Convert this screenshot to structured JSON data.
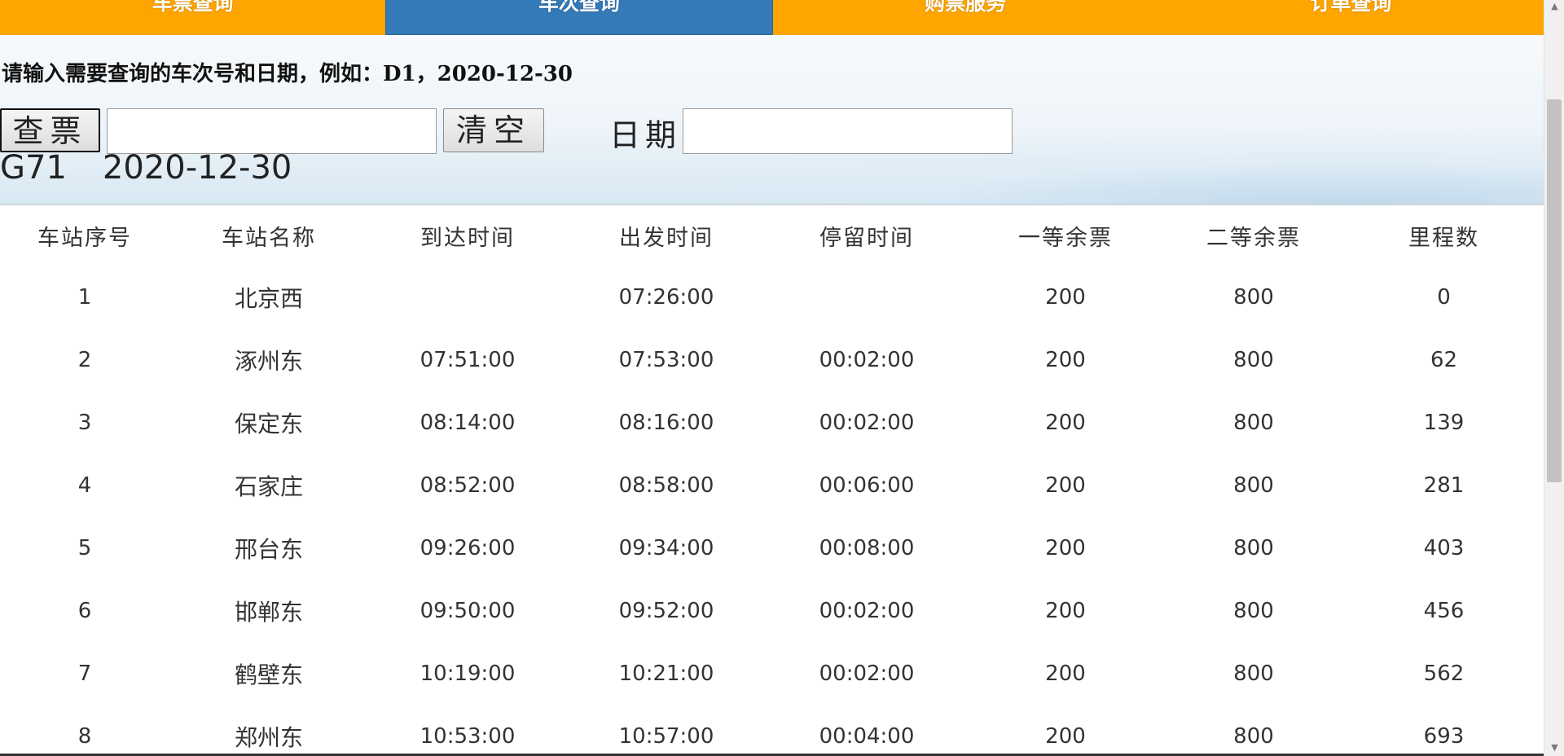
{
  "nav": {
    "tabs": [
      {
        "label": "车票查询",
        "active": false
      },
      {
        "label": "车次查询",
        "active": true
      },
      {
        "label": "购票服务",
        "active": false
      },
      {
        "label": "订单查询",
        "active": false
      }
    ]
  },
  "search": {
    "hint": "请输入需要查询的车次号和日期，例如：D1，2020-12-30",
    "search_button": "查票",
    "train_input_value": "",
    "clear_button": "清空",
    "date_label": "日期",
    "date_input_value": ""
  },
  "result": {
    "train_no": "G71",
    "date": "2020-12-30"
  },
  "table": {
    "headers": [
      "车站序号",
      "车站名称",
      "到达时间",
      "出发时间",
      "停留时间",
      "一等余票",
      "二等余票",
      "里程数"
    ],
    "rows": [
      [
        "1",
        "北京西",
        "",
        "07:26:00",
        "",
        "200",
        "800",
        "0"
      ],
      [
        "2",
        "涿州东",
        "07:51:00",
        "07:53:00",
        "00:02:00",
        "200",
        "800",
        "62"
      ],
      [
        "3",
        "保定东",
        "08:14:00",
        "08:16:00",
        "00:02:00",
        "200",
        "800",
        "139"
      ],
      [
        "4",
        "石家庄",
        "08:52:00",
        "08:58:00",
        "00:06:00",
        "200",
        "800",
        "281"
      ],
      [
        "5",
        "邢台东",
        "09:26:00",
        "09:34:00",
        "00:08:00",
        "200",
        "800",
        "403"
      ],
      [
        "6",
        "邯郸东",
        "09:50:00",
        "09:52:00",
        "00:02:00",
        "200",
        "800",
        "456"
      ],
      [
        "7",
        "鹤壁东",
        "10:19:00",
        "10:21:00",
        "00:02:00",
        "200",
        "800",
        "562"
      ],
      [
        "8",
        "郑州东",
        "10:53:00",
        "10:57:00",
        "00:04:00",
        "200",
        "800",
        "693"
      ]
    ]
  },
  "colors": {
    "nav_orange": "#ffa500",
    "nav_active_blue": "#337ab7"
  },
  "icons": {
    "scroll_up": "scroll-up-arrow-icon",
    "scroll_down": "scroll-down-arrow-icon"
  }
}
